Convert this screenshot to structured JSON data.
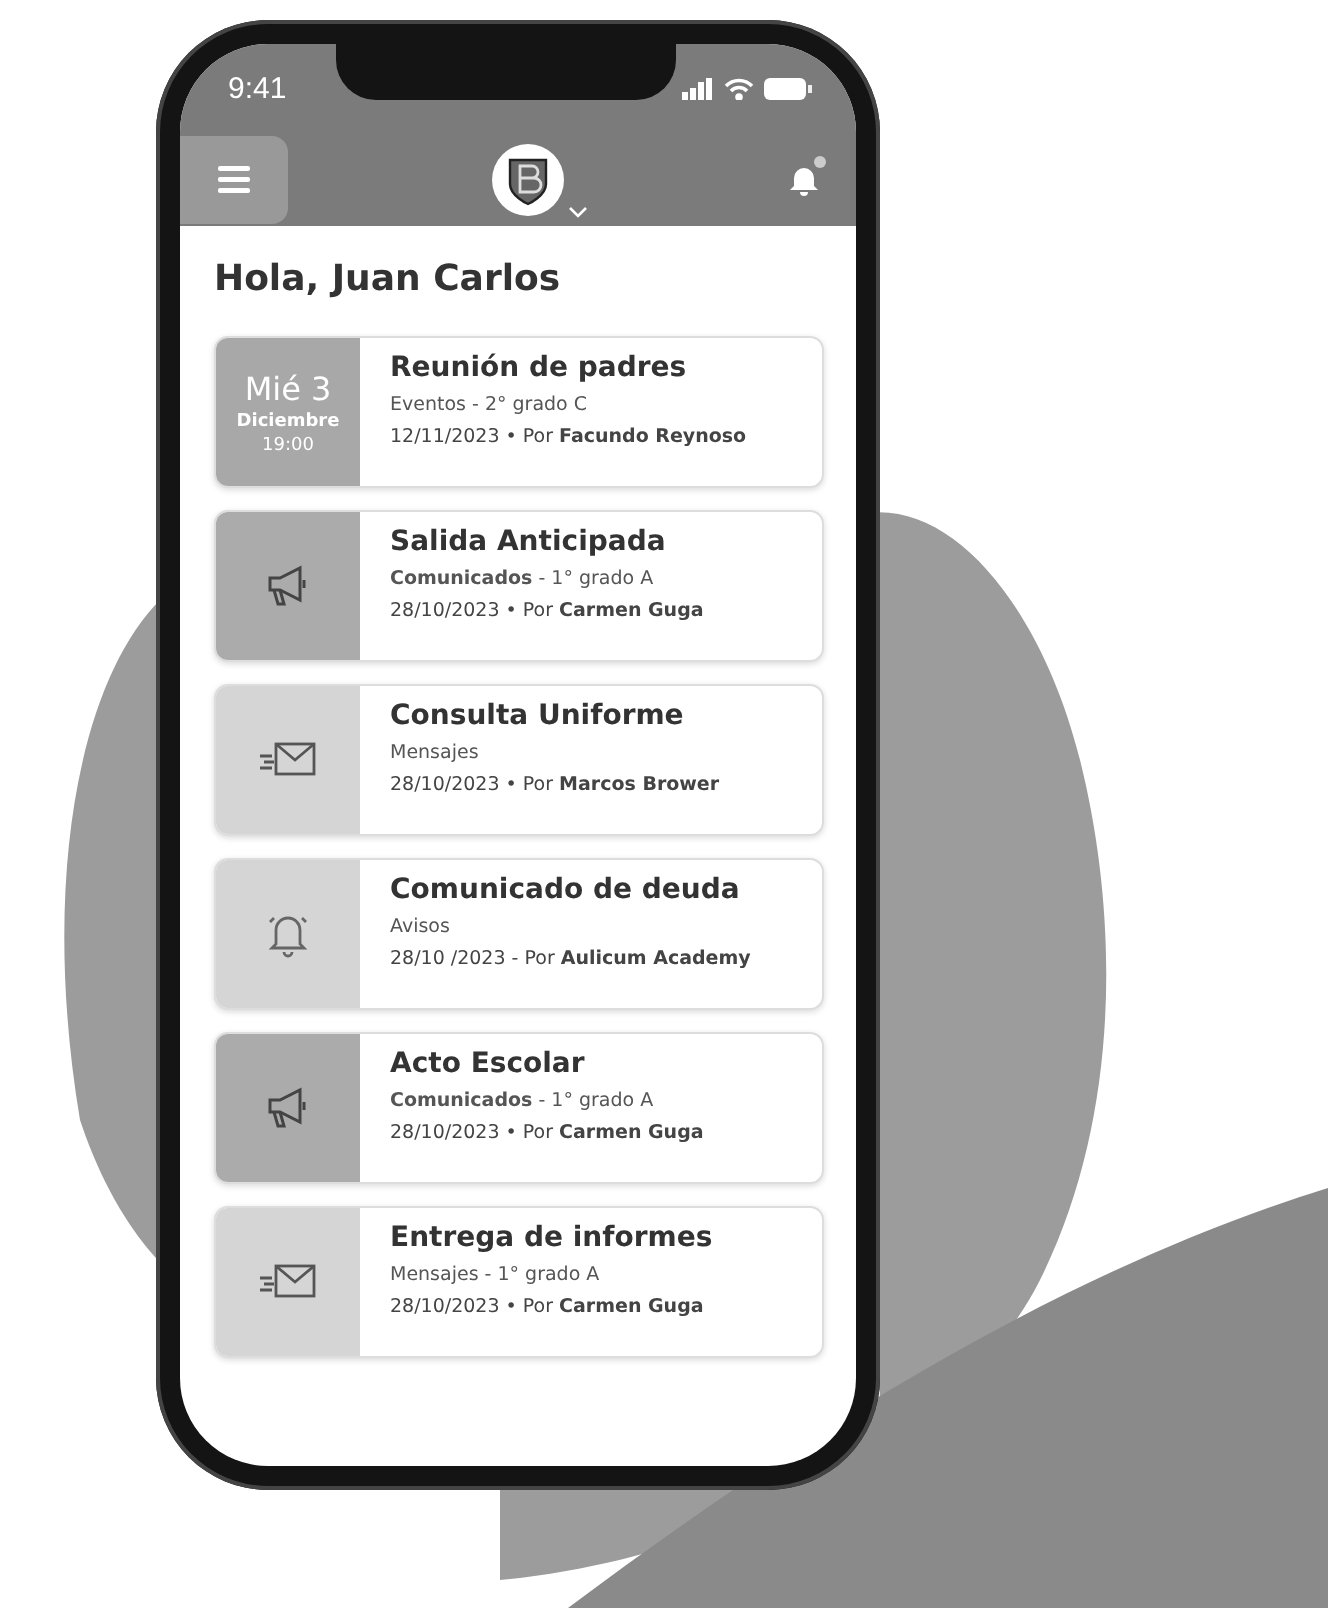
{
  "status_bar": {
    "time": "9:41"
  },
  "header": {
    "has_notification": true
  },
  "greeting": "Hola, Juan Carlos",
  "items": [
    {
      "kind": "date",
      "day": "Mié 3",
      "month": "Diciembre",
      "time": "19:00",
      "title": "Reunión de padres",
      "subtitle": "Eventos - 2° grado C",
      "meta": "12/11/2023 • Por **Facundo Reynoso**"
    },
    {
      "kind": "announcement",
      "title": "Salida Anticipada",
      "subtitle": "**Comunicados** - 1° grado A",
      "meta": "28/10/2023 • Por **Carmen Guga**"
    },
    {
      "kind": "message",
      "title": "Consulta Uniforme",
      "subtitle": "Mensajes",
      "meta": "28/10/2023 • Por **Marcos Brower**"
    },
    {
      "kind": "alert",
      "title": "Comunicado de deuda",
      "subtitle": "Avisos",
      "meta": "28/10 /2023 - Por **Aulicum Academy**"
    },
    {
      "kind": "announcement",
      "title": "Acto Escolar",
      "subtitle": "**Comunicados** - 1° grado A",
      "meta": "28/10/2023 • Por **Carmen Guga**"
    },
    {
      "kind": "message",
      "title": "Entrega de informes",
      "subtitle": "Mensajes - 1° grado A",
      "meta": "28/10/2023 • Por **Carmen Guga**"
    }
  ]
}
